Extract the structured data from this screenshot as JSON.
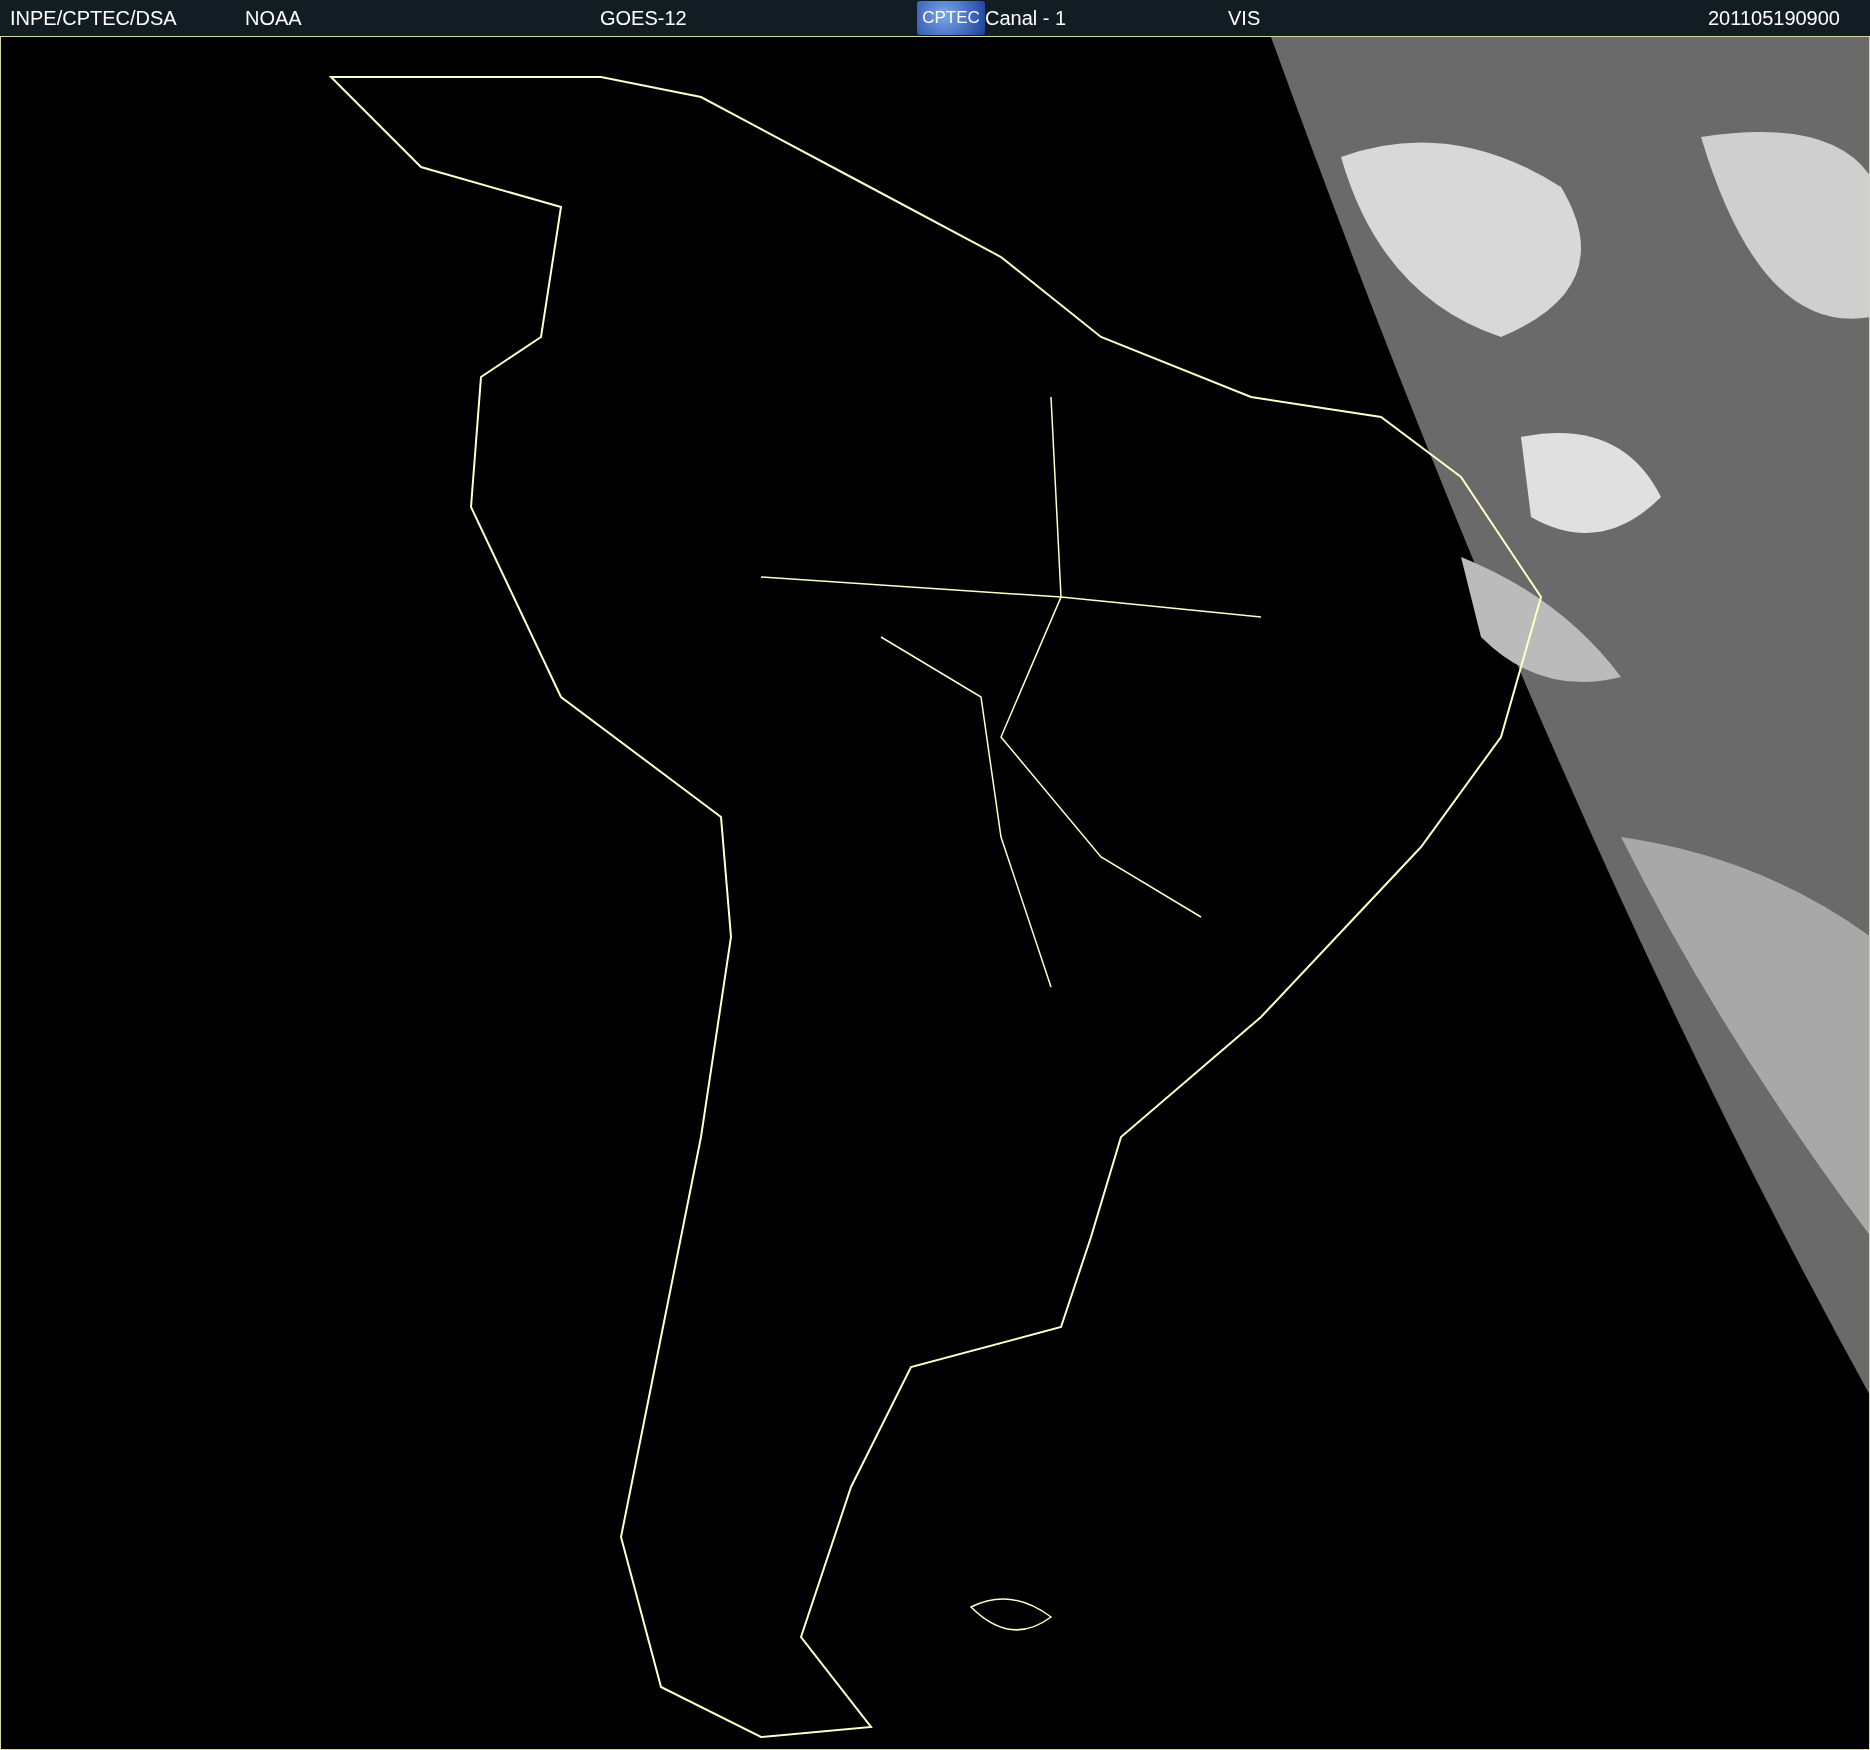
{
  "header": {
    "source": "INPE/CPTEC/DSA",
    "agency": "NOAA",
    "satellite": "GOES-12",
    "logo": "CPTEC",
    "channel": "Canal - 1",
    "band": "VIS",
    "timestamp": "201105190900"
  }
}
